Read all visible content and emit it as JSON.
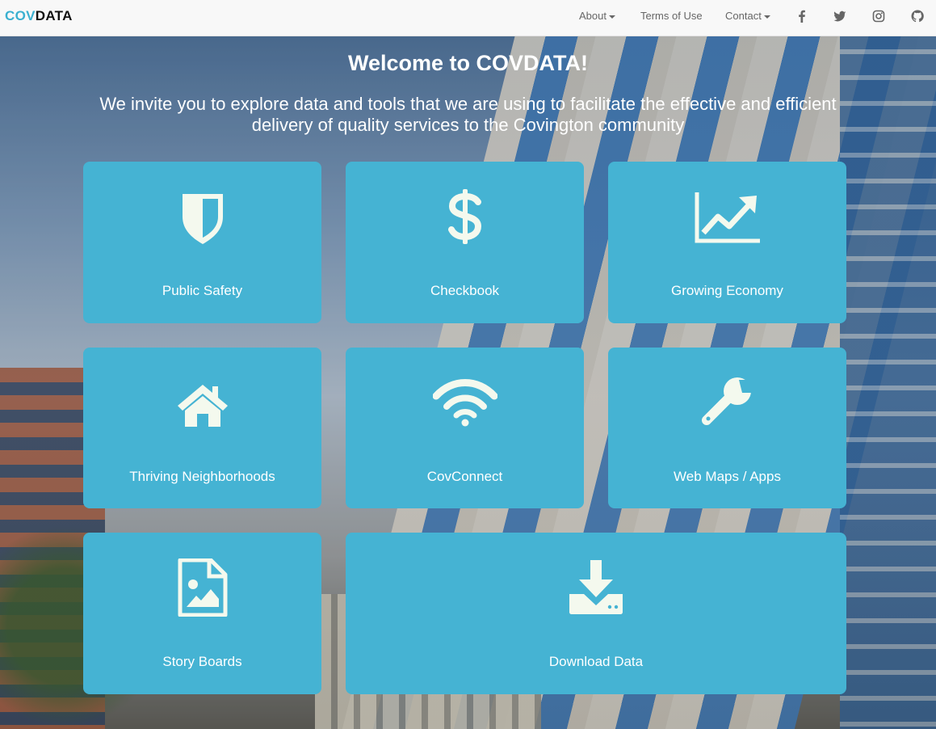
{
  "brand": {
    "part1": "COV",
    "part2": "DATA"
  },
  "nav": {
    "about": "About",
    "terms": "Terms of Use",
    "contact": "Contact",
    "social": [
      "facebook-icon",
      "twitter-icon",
      "instagram-icon",
      "github-icon"
    ]
  },
  "hero": {
    "title": "Welcome to COVDATA!",
    "subtitle": "We invite you to explore data and tools that we are using to facilitate the effective and efficient delivery of quality services to the Covington community"
  },
  "cards": [
    {
      "label": "Public Safety",
      "icon": "shield-icon"
    },
    {
      "label": "Checkbook",
      "icon": "dollar-icon"
    },
    {
      "label": "Growing Economy",
      "icon": "line-chart-icon"
    },
    {
      "label": "Thriving Neighborhoods",
      "icon": "home-icon"
    },
    {
      "label": "CovConnect",
      "icon": "wifi-icon"
    },
    {
      "label": "Web Maps / Apps",
      "icon": "wrench-icon"
    },
    {
      "label": "Story Boards",
      "icon": "file-image-icon"
    },
    {
      "label": "Download Data",
      "icon": "download-icon"
    }
  ],
  "colors": {
    "card": "#45b3d3",
    "icon": "#f4f9ee",
    "brand_accent": "#3ab0d0"
  }
}
